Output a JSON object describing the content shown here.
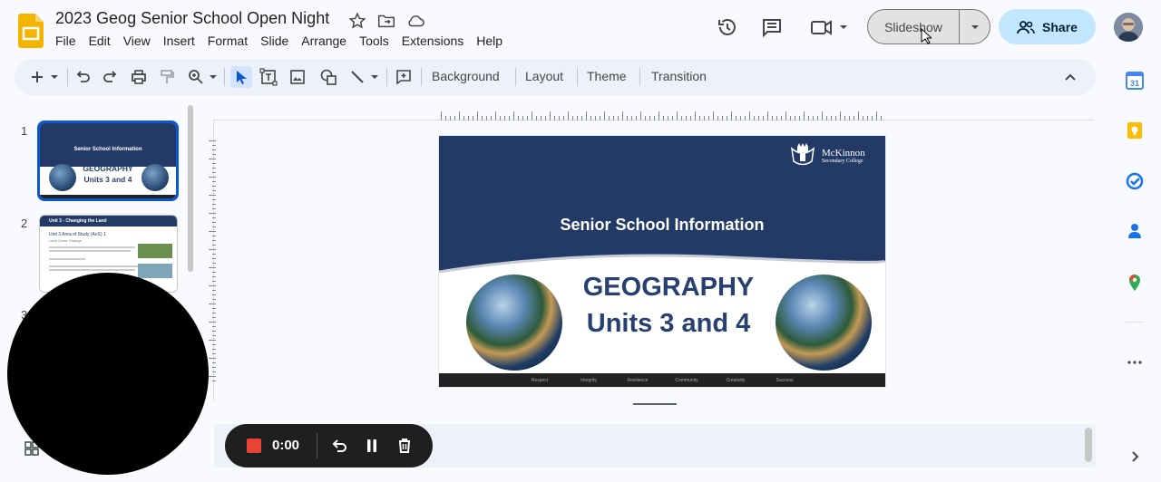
{
  "document": {
    "title": "2023 Geog Senior School Open Night"
  },
  "menu": [
    "File",
    "Edit",
    "View",
    "Insert",
    "Format",
    "Slide",
    "Arrange",
    "Tools",
    "Extensions",
    "Help"
  ],
  "header": {
    "slideshow_label": "Slideshow",
    "share_label": "Share"
  },
  "toolbar": {
    "background_label": "Background",
    "layout_label": "Layout",
    "theme_label": "Theme",
    "transition_label": "Transition"
  },
  "filmstrip": {
    "slides": [
      {
        "number": "1",
        "header": "Senior School Information",
        "title_line1": "GEOGRAPHY",
        "title_line2": "Units 3 and 4"
      },
      {
        "number": "2",
        "header": "Unit 3 - Changing the Land",
        "title": "Unit 3 Area of Study (AoS) 1",
        "subtitle": "Land Cover Change"
      },
      {
        "number": "3"
      }
    ]
  },
  "slide": {
    "subtitle": "Senior School Information",
    "title_line1": "GEOGRAPHY",
    "title_line2": "Units 3 and 4",
    "logo_name": "McKinnon",
    "logo_sub": "Secondary College",
    "footer": [
      "Respect",
      "Integrity",
      "Resilience",
      "Community",
      "Creativity",
      "Success"
    ]
  },
  "recorder": {
    "time": "0:00"
  },
  "colors": {
    "accent": "#0b57d0",
    "slide_blue": "#233a66",
    "title_blue": "#27406f",
    "share_bg": "#c2e7ff",
    "record_red": "#ea4335"
  }
}
